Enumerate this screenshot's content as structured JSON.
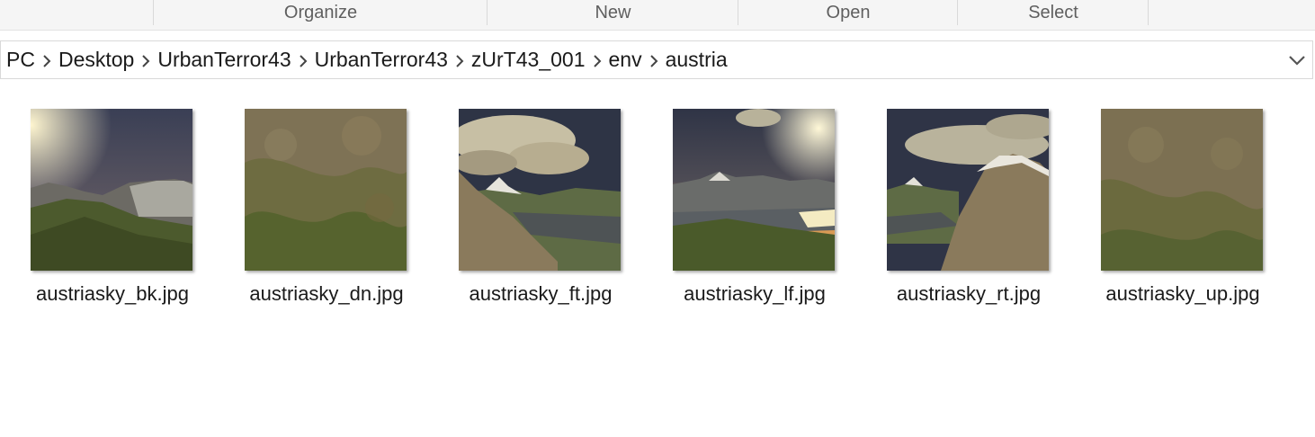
{
  "ribbon": {
    "groups": [
      "Organize",
      "New",
      "Open",
      "Select"
    ]
  },
  "address": {
    "path": [
      "PC",
      "Desktop",
      "UrbanTerror43",
      "UrbanTerror43",
      "zUrT43_001",
      "env",
      "austria"
    ]
  },
  "files": [
    {
      "name": "austriasky_bk.jpg",
      "thumb": "sunset-mountains"
    },
    {
      "name": "austriasky_dn.jpg",
      "thumb": "grass-ground"
    },
    {
      "name": "austriasky_ft.jpg",
      "thumb": "clouds-snowpeak-lake"
    },
    {
      "name": "austriasky_lf.jpg",
      "thumb": "sun-lake-mountains"
    },
    {
      "name": "austriasky_rt.jpg",
      "thumb": "clouds-hillside"
    },
    {
      "name": "austriasky_up.jpg",
      "thumb": "grass-ground"
    }
  ],
  "colors": {
    "sky_dark": "#2f3446",
    "sky_glow": "#d89a55",
    "grass": "#5d6b35",
    "rock": "#8a7a5c"
  }
}
